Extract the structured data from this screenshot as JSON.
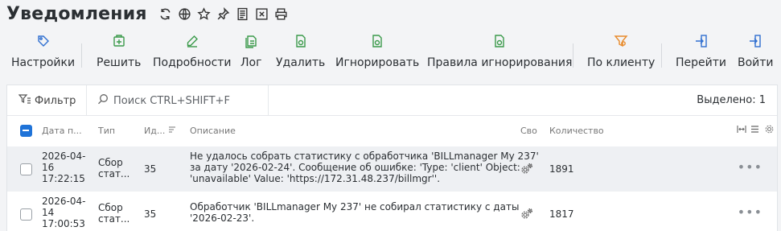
{
  "page": {
    "title": "Уведомления"
  },
  "title_icons": [
    "refresh-icon",
    "globe-icon",
    "star-icon",
    "pin-icon",
    "list-icon",
    "excel-icon",
    "print-icon"
  ],
  "toolbar": {
    "settings": "Настройки",
    "solve": "Решить",
    "details": "Подробности",
    "log": "Лог",
    "delete": "Удалить",
    "ignore": "Игнорировать",
    "ignore_rules": "Правила игнорирования",
    "by_client": "По клиенту",
    "goto": "Перейти",
    "login": "Войти"
  },
  "colors": {
    "accent": "#1f73d8",
    "green": "#3a9a4a",
    "orange": "#e88a2a",
    "blue": "#2f6fd0"
  },
  "filterbar": {
    "filter_label": "Фильтр",
    "search_placeholder": "Поиск CTRL+SHIFT+F",
    "selected": "Выделено: 1"
  },
  "table": {
    "columns": {
      "date": "Дата п...",
      "type": "Тип",
      "id": "Ид...",
      "description": "Описание",
      "prop": "Сво",
      "count": "Количество"
    },
    "rows": [
      {
        "date": [
          "2026-04-",
          "16",
          "17:22:15"
        ],
        "type": [
          "Сбор",
          "стат..."
        ],
        "id": "35",
        "description": [
          "Не удалось собрать статистику с обработчика 'BILLmanager My 237'",
          "за дату '2026-02-24'. Сообщение об ошибке: 'Type: 'client' Object:",
          "'unavailable' Value: 'https://172.31.48.237/billmgr''."
        ],
        "count": "1891",
        "selected": false
      },
      {
        "date": [
          "2026-04-",
          "14",
          "17:00:53"
        ],
        "type": [
          "Сбор",
          "стат..."
        ],
        "id": "35",
        "description": [
          "Обработчик 'BILLmanager My 237' не собирал статистику с даты",
          "'2026-02-23'."
        ],
        "count": "1817",
        "selected": false
      }
    ]
  }
}
